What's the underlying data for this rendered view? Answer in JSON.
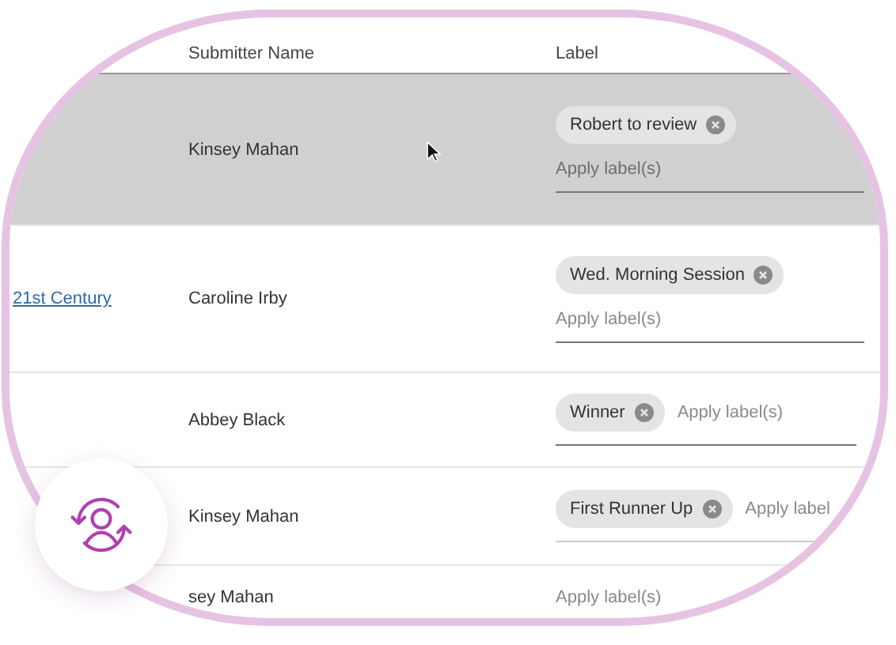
{
  "table": {
    "columns": [
      {
        "label": "Submitter Name"
      },
      {
        "label": "Label"
      }
    ],
    "rows": [
      {
        "selected": true,
        "submitter": "Kinsey Mahan",
        "kind": "stacked",
        "labels": [
          "Robert to review"
        ],
        "placeholder": "Apply label(s)"
      },
      {
        "selected": false,
        "title": "21st Century",
        "submitter": "Caroline Irby",
        "kind": "stacked",
        "labels": [
          "Wed. Morning Session"
        ],
        "placeholder": "Apply label(s)"
      },
      {
        "selected": false,
        "submitter": "Abbey Black",
        "kind": "inline",
        "labels": [
          "Winner"
        ],
        "placeholder": "Apply label(s)"
      },
      {
        "selected": false,
        "submitter": "Kinsey Mahan",
        "kind": "inline",
        "labels": [
          "First Runner Up"
        ],
        "placeholder": "Apply label"
      },
      {
        "selected": false,
        "submitter": "sey Mahan",
        "kind": "stacked",
        "labels": [],
        "placeholder": "Apply label(s)"
      }
    ]
  }
}
